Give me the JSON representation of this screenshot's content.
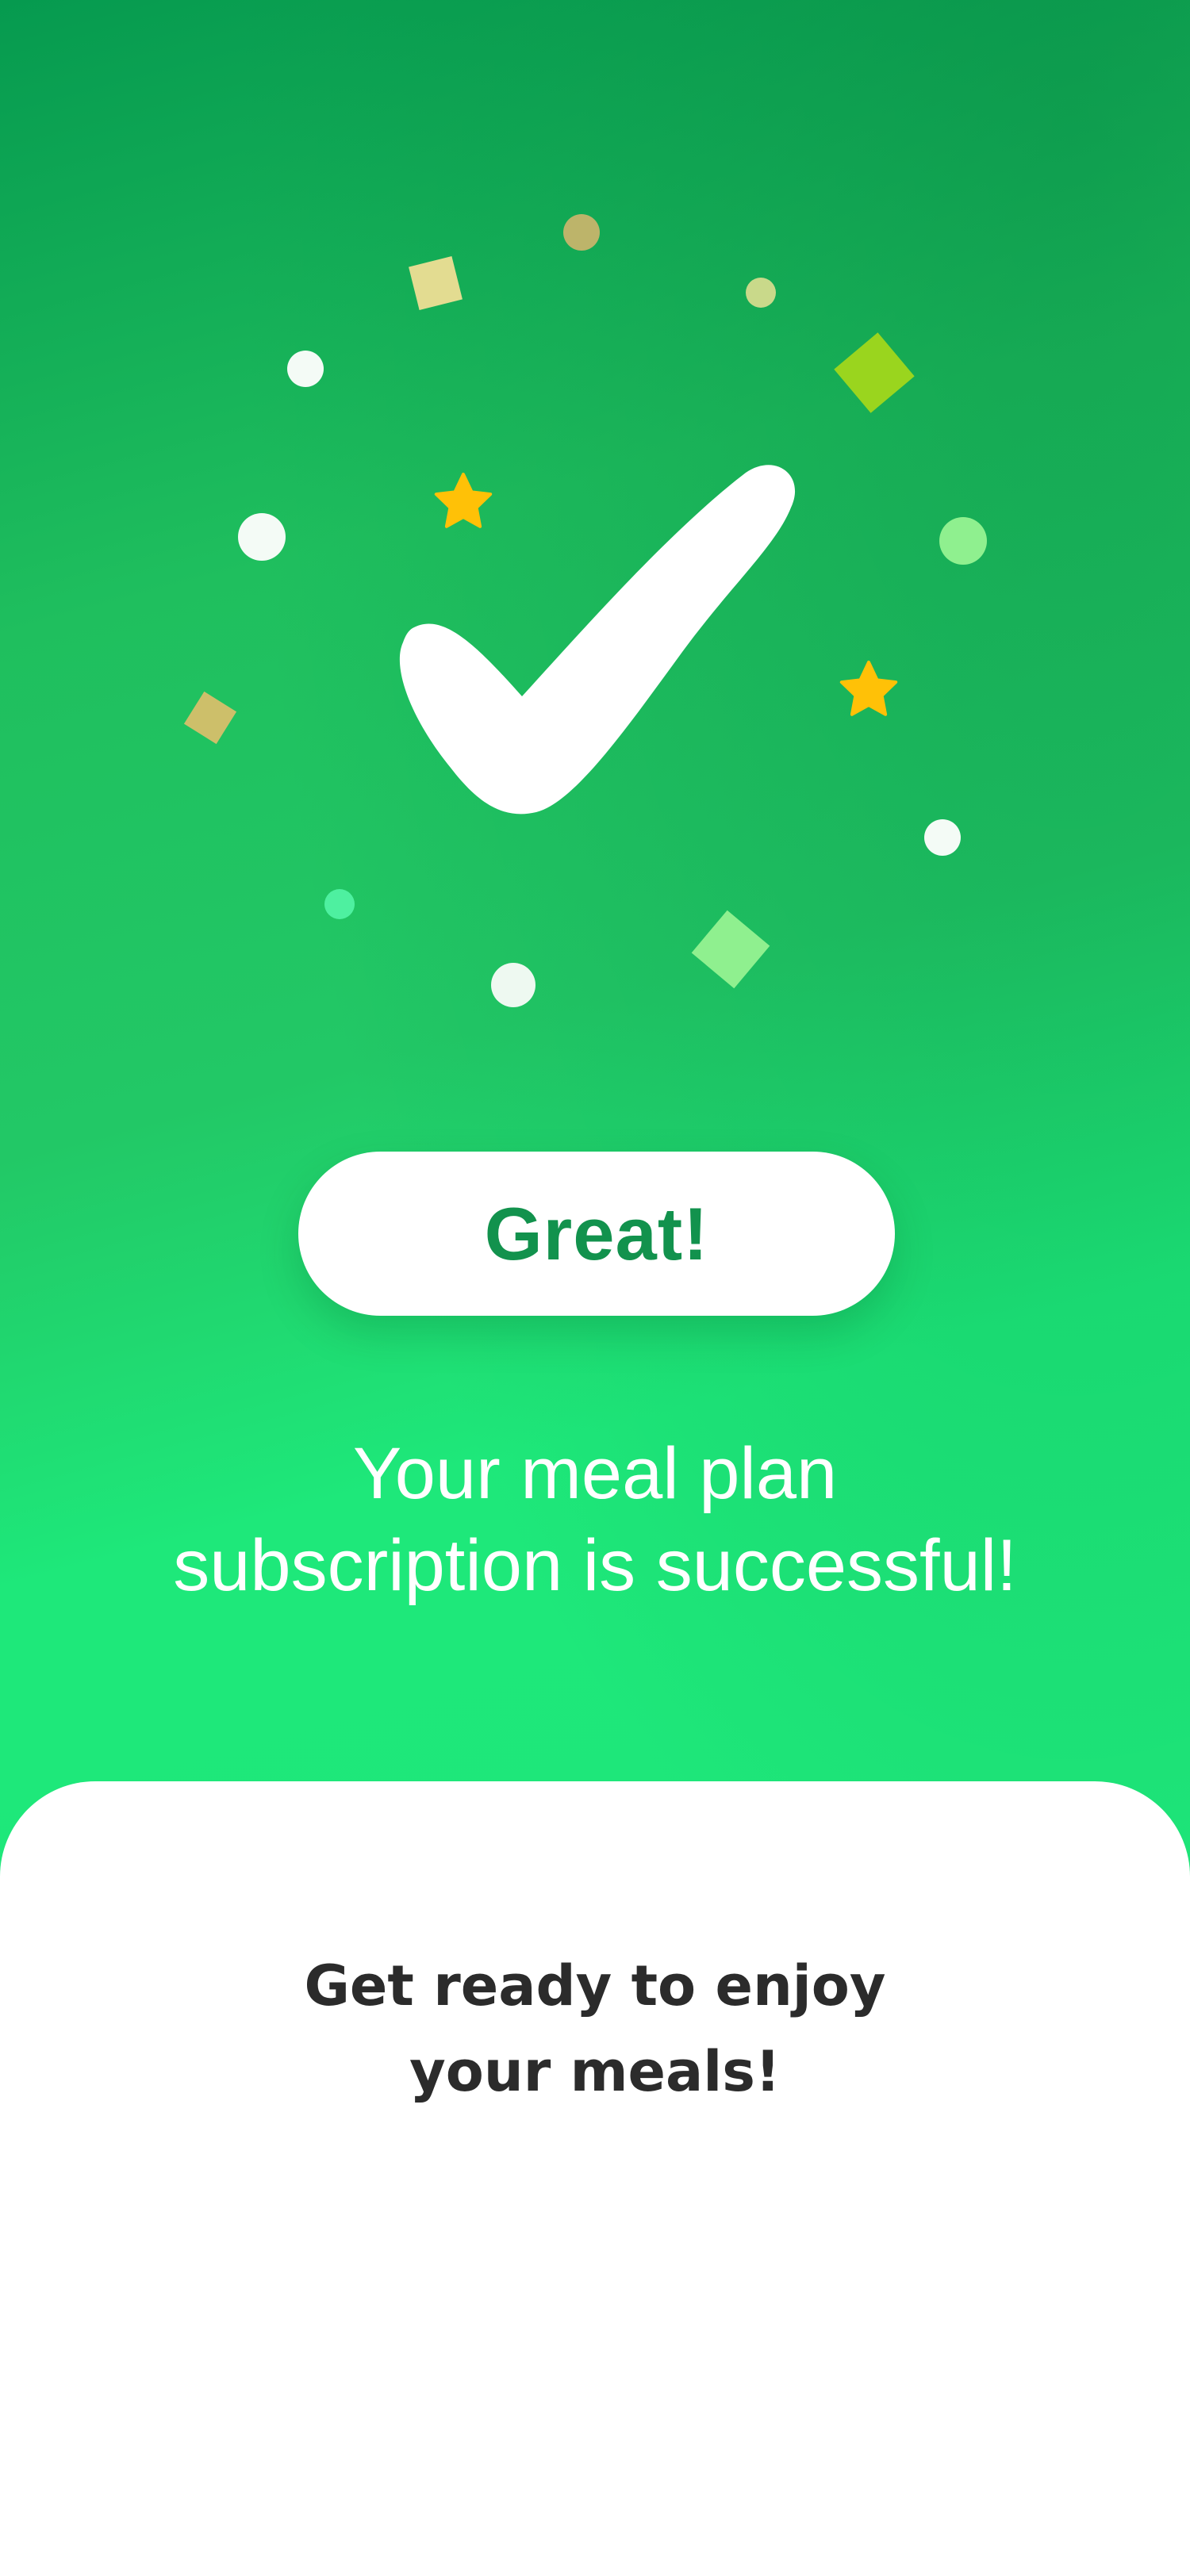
{
  "success": {
    "button_label": "Great!",
    "message_line1": "Your meal plan",
    "message_line2": "subscription is successful!"
  },
  "sheet": {
    "heading_line1": "Get ready to enjoy",
    "heading_line2": "your meals!"
  },
  "colors": {
    "brand_green": "#12924d",
    "gradient_dark": "#069a4f",
    "gradient_light": "#1ee87a",
    "star_yellow": "#ffc107",
    "confetti_olive": "#c2b56a",
    "confetti_lime": "#9ad51e",
    "confetti_mint": "#8ff08f",
    "text_dark": "#2b2b2b"
  },
  "icons": {
    "checkmark": "checkmark-icon",
    "star": "star-icon"
  }
}
